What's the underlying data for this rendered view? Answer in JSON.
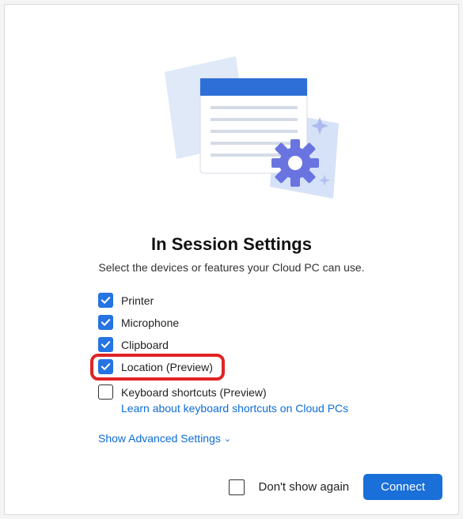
{
  "title": "In Session Settings",
  "subtitle": "Select the devices or features your Cloud PC can use.",
  "options": {
    "printer": {
      "label": "Printer",
      "checked": true
    },
    "microphone": {
      "label": "Microphone",
      "checked": true
    },
    "clipboard": {
      "label": "Clipboard",
      "checked": true
    },
    "location": {
      "label": "Location (Preview)",
      "checked": true,
      "highlighted": true
    },
    "keyboard": {
      "label": "Keyboard shortcuts (Preview)",
      "checked": false,
      "sublink": "Learn about keyboard shortcuts on Cloud PCs"
    }
  },
  "advanced_link": "Show Advanced Settings",
  "footer": {
    "dont_show_label": "Don't show again",
    "dont_show_checked": false,
    "connect_label": "Connect"
  },
  "colors": {
    "accent": "#2673e3",
    "link": "#0e6dd8",
    "highlight": "#e02424",
    "connect_button": "#1a6fd8"
  }
}
